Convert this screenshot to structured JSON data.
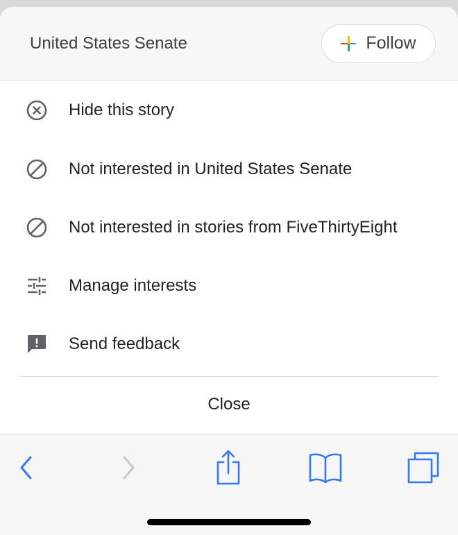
{
  "header": {
    "title": "United States Senate",
    "follow_label": "Follow",
    "follow_icon": "multicolor-plus-icon"
  },
  "menu": {
    "items": [
      {
        "label": "Hide this story",
        "icon": "close-circle-icon"
      },
      {
        "label": "Not interested in United States Senate",
        "icon": "block-icon"
      },
      {
        "label": "Not interested in stories from FiveThirtyEight",
        "icon": "block-icon"
      },
      {
        "label": "Manage interests",
        "icon": "tune-icon"
      },
      {
        "label": "Send feedback",
        "icon": "feedback-icon"
      }
    ],
    "close_label": "Close"
  },
  "toolbar": {
    "buttons": [
      "back-icon",
      "forward-icon",
      "share-icon",
      "bookmarks-icon",
      "tabs-icon"
    ],
    "accent": "#3478f6",
    "disabled": "#c7c7cc"
  },
  "colors": {
    "text": "#202124",
    "icon": "#5f6368",
    "plus": [
      "#ea4335",
      "#4285f4",
      "#fbbc05",
      "#34a853"
    ]
  }
}
